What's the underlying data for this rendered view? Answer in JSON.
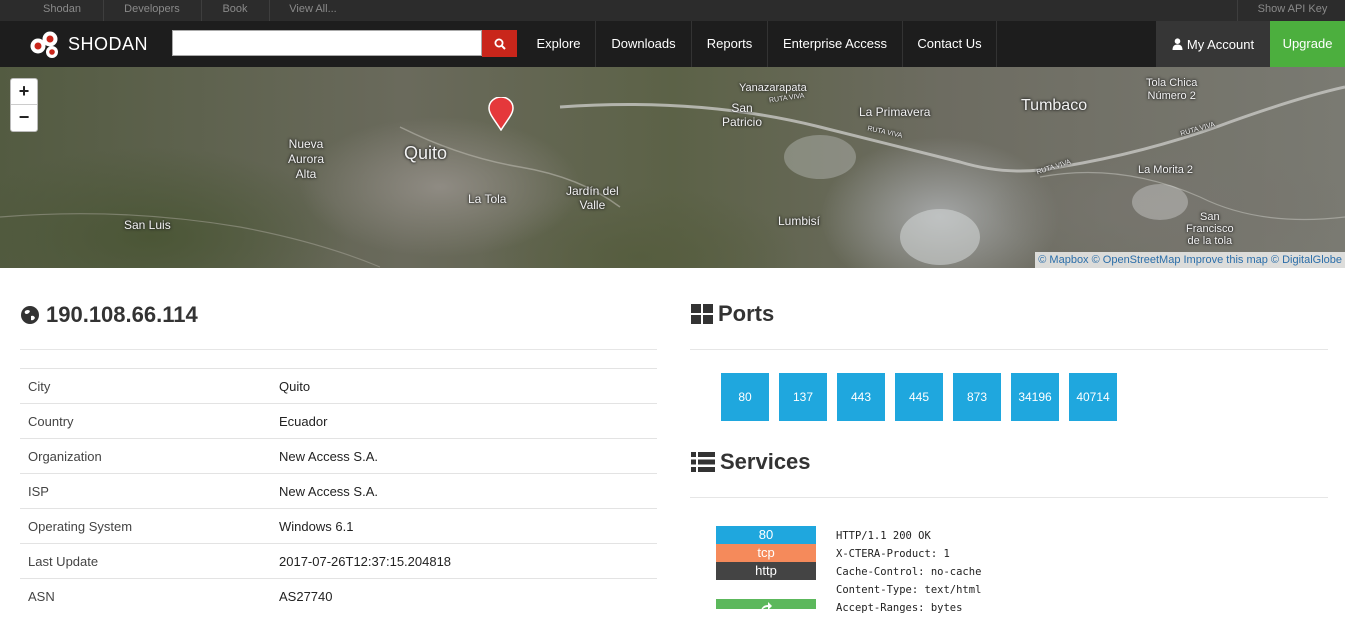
{
  "topbar": {
    "links": [
      "Shodan",
      "Developers",
      "Book",
      "View All..."
    ],
    "api_key": "Show API Key"
  },
  "nav": {
    "brand": "SHODAN",
    "search": {
      "value": "",
      "placeholder": ""
    },
    "search_icon": "search-icon",
    "items": [
      "Explore",
      "Downloads",
      "Reports",
      "Enterprise Access",
      "Contact Us"
    ],
    "account": "My Account",
    "account_icon": "user-icon",
    "upgrade": "Upgrade",
    "colors": {
      "search_button": "#c9261b",
      "upgrade": "#4caf3e"
    }
  },
  "map": {
    "zoom_in": "+",
    "zoom_out": "−",
    "labels": {
      "quito": "Quito",
      "nueva_aurora": "Nueva\nAurora\nAlta",
      "san_luis": "San Luis",
      "la_tola": "La Tola",
      "jardin": "Jardín del\nValle",
      "yanazarapata": "Yanazarapata",
      "ruta_viva_1": "RUTA VIVA",
      "san_patricio": "San\nPatricio",
      "la_primavera": "La Primavera",
      "ruta_viva_2": "RUTA VIVA",
      "lumbisi": "Lumbisí",
      "tumbaco": "Tumbaco",
      "tola_chica": "Tola Chica\nNúmero 2",
      "ruta_viva_3": "RUTA VIVA",
      "ruta_viva_4": "RUTA VIVA",
      "la_morita": "La Morita 2",
      "san_francisco": "San\nFrancisco\nde la tola"
    },
    "attribution": "© Mapbox © OpenStreetMap Improve this map © DigitalGlobe",
    "marker_icon": "map-marker-icon"
  },
  "host": {
    "ip": "190.108.66.114",
    "icon": "globe-icon",
    "rows": [
      {
        "key": "City",
        "value": "Quito"
      },
      {
        "key": "Country",
        "value": "Ecuador"
      },
      {
        "key": "Organization",
        "value": "New Access S.A."
      },
      {
        "key": "ISP",
        "value": "New Access S.A."
      },
      {
        "key": "Operating System",
        "value": "Windows 6.1"
      },
      {
        "key": "Last Update",
        "value": "2017-07-26T12:37:15.204818"
      },
      {
        "key": "ASN",
        "value": "AS27740"
      }
    ]
  },
  "ports": {
    "title": "Ports",
    "icon": "grid-icon",
    "list": [
      "80",
      "137",
      "443",
      "445",
      "873",
      "34196",
      "40714"
    ],
    "color": "#1fa7de"
  },
  "services": {
    "title": "Services",
    "icon": "list-icon",
    "first": {
      "port": "80",
      "transport": "tcp",
      "protocol": "http",
      "colors": {
        "port": "#1fa7de",
        "transport": "#f58a5b",
        "protocol": "#444444"
      },
      "banner": "HTTP/1.1 200 OK\nX-CTERA-Product: 1\nCache-Control: no-cache\nContent-Type: text/html\nAccept-Ranges: bytes"
    },
    "next_icon": "share-icon"
  }
}
